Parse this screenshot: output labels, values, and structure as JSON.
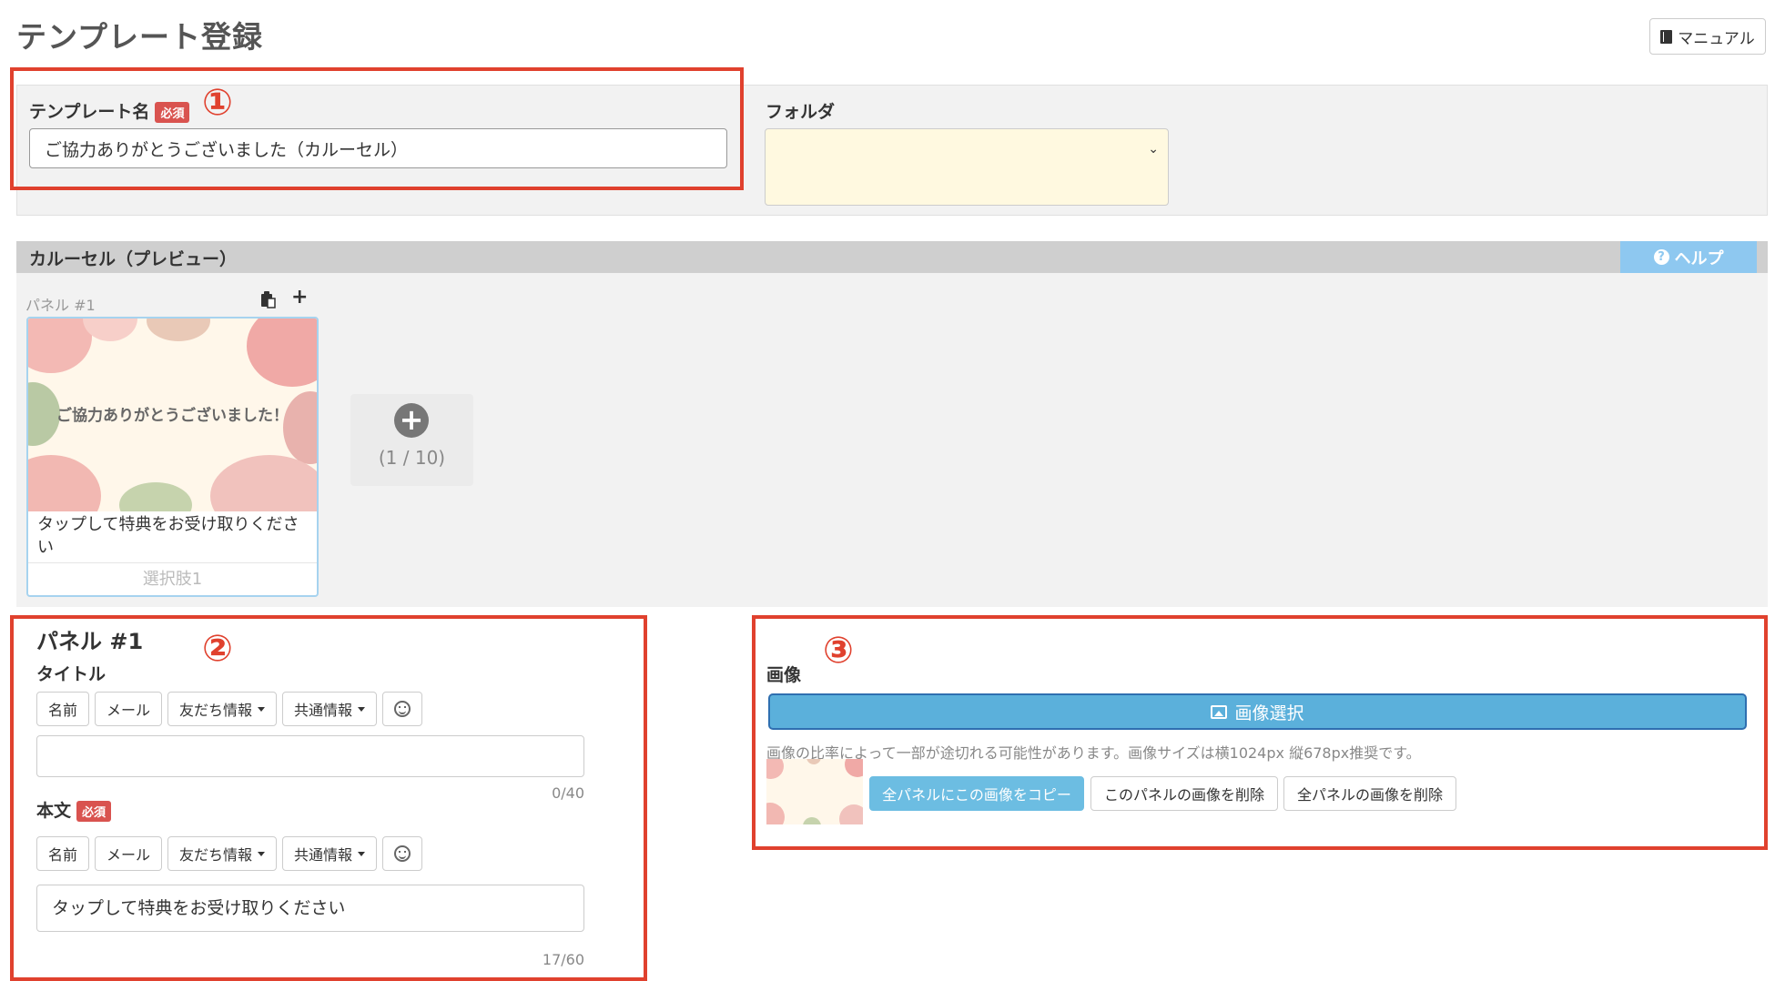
{
  "page": {
    "title": "テンプレート登録",
    "manual_label": "マニュアル"
  },
  "template_form": {
    "name_label": "テンプレート名",
    "required_badge": "必須",
    "name_value": "ご協力ありがとうございました（カルーセル）",
    "folder_label": "フォルダ",
    "folder_value": ""
  },
  "carousel": {
    "header_title": "カルーセル（プレビュー）",
    "help_label": "ヘルプ",
    "panel_label": "パネル #1",
    "card": {
      "image_text": "ご協力ありがとうございました！",
      "body_text": "タップして特典をお受け取りください",
      "choice_label": "選択肢1"
    },
    "add_count": "(1 / 10)"
  },
  "annotations": {
    "marker_1": "①",
    "marker_2": "②",
    "marker_3": "③",
    "highlight_color": "#e0412e"
  },
  "panel_editor": {
    "title": "パネル #1",
    "title_field_label": "タイトル",
    "title_value": "",
    "title_counter": "0/40",
    "body_field_label": "本文",
    "body_required_badge": "必須",
    "body_value": "タップして特典をお受け取りください",
    "body_counter": "17/60",
    "insert_buttons": {
      "name": "名前",
      "mail": "メール",
      "friend_info": "友だち情報",
      "common_info": "共通情報",
      "emoji": "smile-icon"
    }
  },
  "image_editor": {
    "label": "画像",
    "select_button": "画像選択",
    "note": "画像の比率によって一部が途切れる可能性があります。画像サイズは横1024px 縦678px推奨です。",
    "copy_all_button": "全パネルにこの画像をコピー",
    "delete_this_button": "このパネルの画像を削除",
    "delete_all_button": "全パネルの画像を削除"
  },
  "colors": {
    "accent_blue": "#5bb0db",
    "help_blue": "#8ec8f0",
    "required_red": "#d9534f",
    "folder_bg": "#fff9e0"
  }
}
